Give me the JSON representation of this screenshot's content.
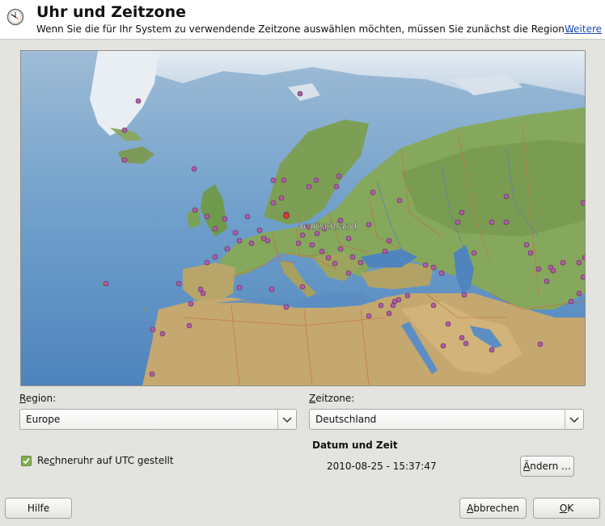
{
  "header": {
    "title": "Uhr und Zeitzone",
    "subtitle": "Wenn Sie die für Ihr System zu verwendende Zeitzone auswählen möchten, müssen Sie zunächst die Region …",
    "more_link": "Weitere"
  },
  "map": {
    "selected_label": "Deutschland"
  },
  "region": {
    "label_prefix": "",
    "label_accel": "R",
    "label_rest": "egion:",
    "value": "Europe"
  },
  "timezone": {
    "label_prefix": "",
    "label_accel": "Z",
    "label_rest": "eitzone:",
    "value": "Deutschland"
  },
  "utc_checkbox": {
    "checked": true,
    "label_prefix": "Re",
    "label_accel": "c",
    "label_rest": "hneruhr auf UTC gestellt"
  },
  "datetime": {
    "heading": "Datum und Zeit",
    "value": "2010-08-25 - 15:37:47",
    "change_prefix": "",
    "change_accel": "Ä",
    "change_rest": "ndern …"
  },
  "buttons": {
    "help": "Hilfe",
    "cancel_accel": "A",
    "cancel_rest": "bbrechen",
    "ok_accel": "O",
    "ok_rest": "K"
  },
  "colors": {
    "link": "#1a4fb5",
    "city_dot": "#b05ca8",
    "checkbox": "#7fae50"
  }
}
